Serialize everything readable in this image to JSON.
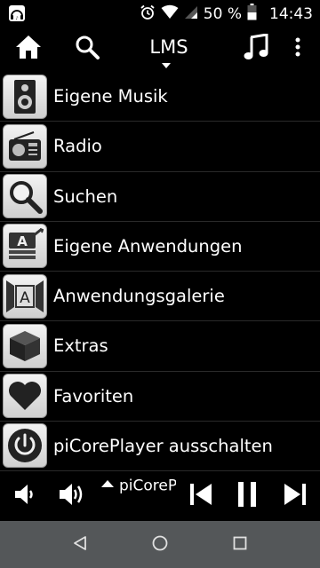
{
  "status_bar": {
    "battery_percent": "50 %",
    "time": "14:43"
  },
  "toolbar": {
    "title": "LMS"
  },
  "menu": {
    "items": [
      {
        "label": "Eigene Musik",
        "icon": "speaker-icon"
      },
      {
        "label": "Radio",
        "icon": "radio-icon"
      },
      {
        "label": "Suchen",
        "icon": "magnifier-icon"
      },
      {
        "label": "Eigene Anwendungen",
        "icon": "my-apps-icon"
      },
      {
        "label": "Anwendungsgalerie",
        "icon": "app-gallery-icon"
      },
      {
        "label": "Extras",
        "icon": "cube-icon"
      },
      {
        "label": "Favoriten",
        "icon": "heart-icon"
      },
      {
        "label": "piCorePlayer ausschalten",
        "icon": "power-icon"
      }
    ]
  },
  "now_playing": {
    "track": "piCorePlayer ausschalten"
  },
  "colors": {
    "background": "#000000",
    "text": "#ffffff",
    "nav_bar": "#545759",
    "icon_tile": "#e6e6e6"
  }
}
